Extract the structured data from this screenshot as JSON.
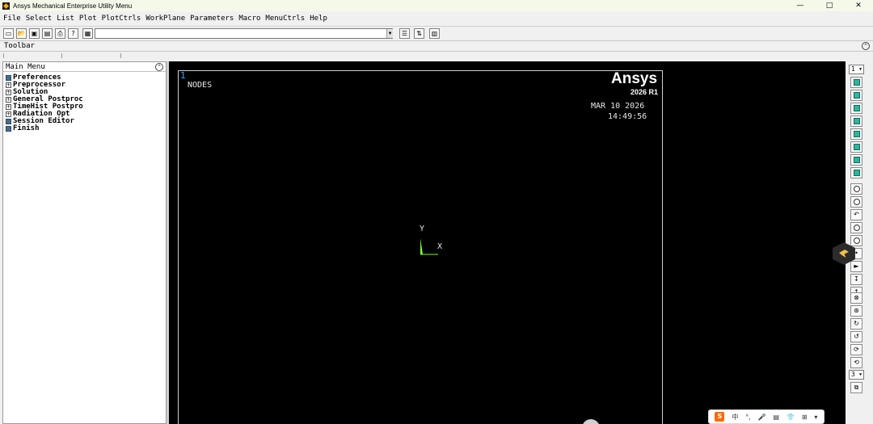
{
  "window": {
    "title": "Ansys Mechanical Enterprise Utility Menu",
    "controls": {
      "minimize": "—",
      "maximize": "□",
      "close": "✕"
    }
  },
  "menubar": {
    "items": [
      "File",
      "Select",
      "List",
      "Plot",
      "PlotCtrls",
      "WorkPlane",
      "Parameters",
      "Macro",
      "MenuCtrls",
      "Help"
    ]
  },
  "toolbar": {
    "label": "Toolbar",
    "command_input": {
      "value": "",
      "placeholder": ""
    },
    "icons": [
      "new-icon",
      "open-icon",
      "save-icon",
      "print-setup-icon",
      "print-icon",
      "help-icon",
      "image-capture-icon",
      "contact-manager-icon",
      "report-generator-icon",
      "unit-icon"
    ]
  },
  "main_menu": {
    "title": "Main Menu",
    "items": [
      {
        "label": "Preferences",
        "type": "action"
      },
      {
        "label": "Preprocessor",
        "type": "folder"
      },
      {
        "label": "Solution",
        "type": "folder"
      },
      {
        "label": "General Postproc",
        "type": "folder"
      },
      {
        "label": "TimeHist Postpro",
        "type": "folder"
      },
      {
        "label": "Radiation Opt",
        "type": "folder"
      },
      {
        "label": "Session Editor",
        "type": "action"
      },
      {
        "label": "Finish",
        "type": "action"
      }
    ]
  },
  "graphics": {
    "window_number": "1",
    "plot_label": "NODES",
    "brand": "Ansys",
    "release": "2026 R1",
    "date": "MAR 10 2026",
    "time": "14:49:56",
    "axis_y": "Y",
    "axis_x": "X",
    "triad_color": "#7cff3a"
  },
  "view_toolbar": {
    "window_select": "1",
    "rotation_increment": "3"
  },
  "ime_bar": {
    "logo": "S",
    "items": [
      "中",
      "°,",
      "🎤",
      "▤",
      "👕",
      "⊞",
      "▾"
    ]
  }
}
